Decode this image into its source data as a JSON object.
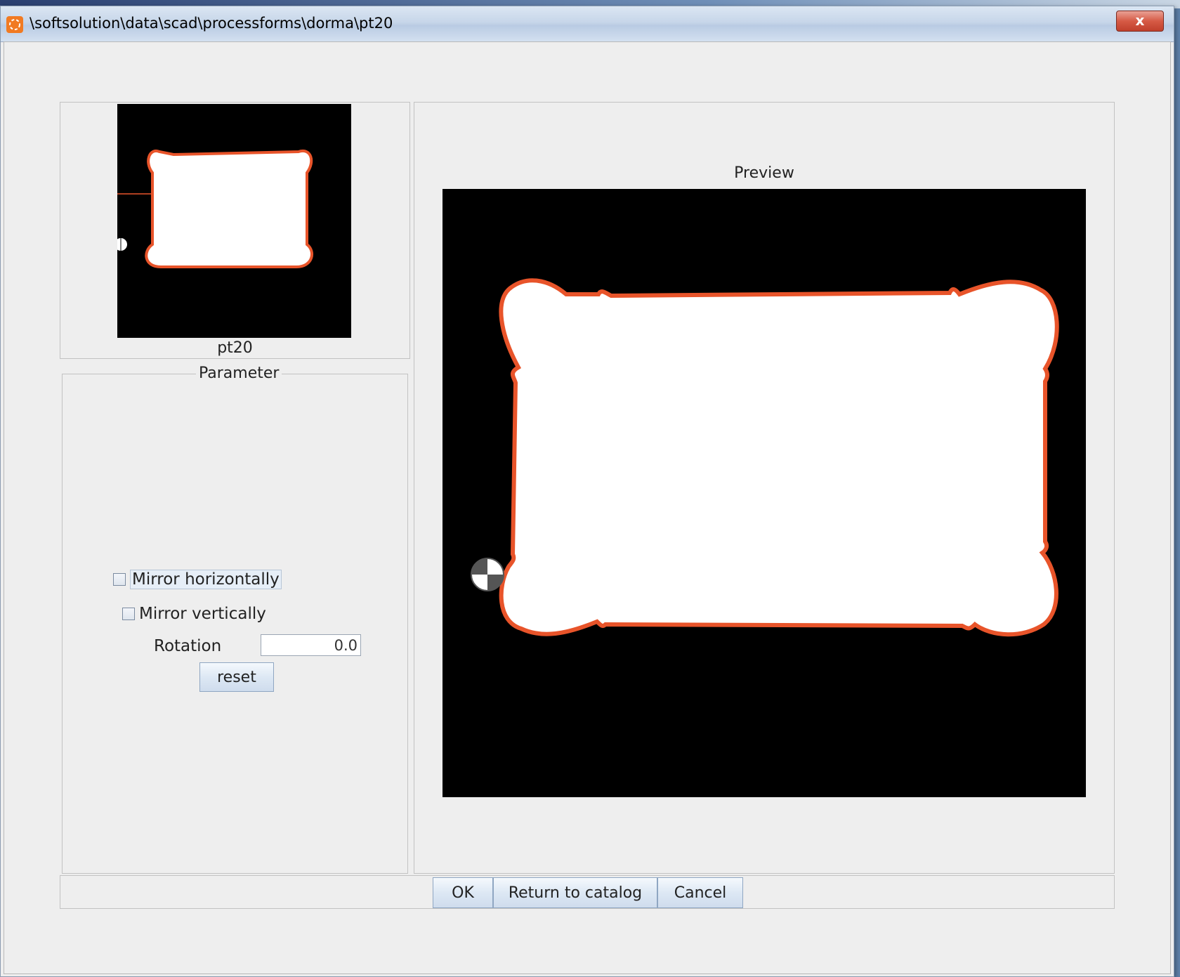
{
  "window": {
    "title": "\\softsolution\\data\\scad\\processforms\\dorma\\pt20",
    "close_label": "x"
  },
  "thumbnail": {
    "caption": "pt20"
  },
  "parameter": {
    "legend": "Parameter",
    "mirror_horizontally_label": "Mirror horizontally",
    "mirror_horizontally_checked": false,
    "mirror_vertically_label": "Mirror vertically",
    "mirror_vertically_checked": false,
    "rotation_label": "Rotation",
    "rotation_value": "0.0",
    "reset_label": "reset"
  },
  "preview": {
    "label": "Preview"
  },
  "buttons": {
    "ok": "OK",
    "return_to_catalog": "Return to catalog",
    "cancel": "Cancel"
  },
  "colors": {
    "shape_outline": "#e8542a",
    "shape_fill": "#ffffff",
    "canvas_background": "#000000"
  }
}
